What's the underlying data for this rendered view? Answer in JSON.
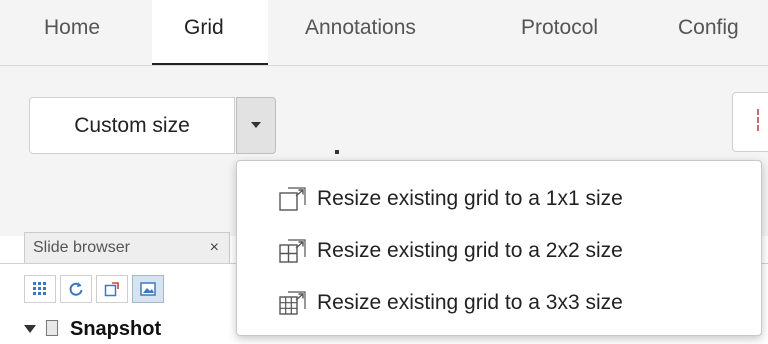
{
  "tabs": [
    {
      "label": "Home"
    },
    {
      "label": "Grid",
      "active": true
    },
    {
      "label": "Annotations"
    },
    {
      "label": "Protocol"
    },
    {
      "label": "Config"
    }
  ],
  "ribbon": {
    "custom_size_label": "Custom size"
  },
  "dropdown": {
    "items": [
      {
        "label": "Resize existing grid to a 1x1 size",
        "icon": "resize-grid-1x1-icon"
      },
      {
        "label": "Resize existing grid to a 2x2 size",
        "icon": "resize-grid-2x2-icon"
      },
      {
        "label": "Resize existing grid to a 3x3 size",
        "icon": "resize-grid-3x3-icon"
      }
    ]
  },
  "slide_browser": {
    "title": "Slide browser",
    "close_glyph": "×",
    "tools": [
      {
        "icon": "grid-view-icon"
      },
      {
        "icon": "refresh-icon"
      },
      {
        "icon": "new-window-icon"
      },
      {
        "icon": "image-view-icon",
        "active": true
      }
    ],
    "tree_root": "Snapshot"
  },
  "colors": {
    "accent": "#222222",
    "ribbon_bg": "#f4f4f4",
    "active_tool_bg": "#d7e4f0",
    "tool_icon_blue": "#3a78c0"
  }
}
